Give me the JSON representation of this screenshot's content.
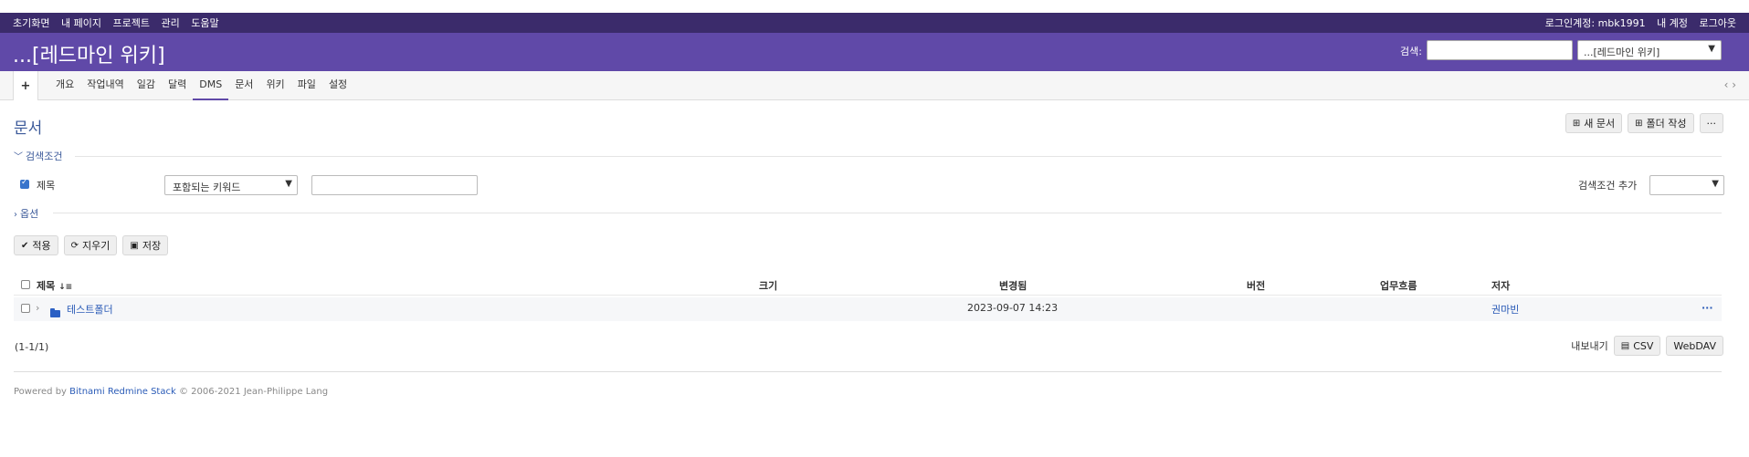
{
  "top_menu": {
    "items": [
      "초기화면",
      "내 페이지",
      "프로젝트",
      "관리",
      "도움말"
    ],
    "logged_in": "로그인계정: mbk1991",
    "my_account": "내 계정",
    "logout": "로그아웃"
  },
  "header": {
    "title": "...[레드마인 위키]",
    "search_label": "검색:",
    "project_jump": "...[레드마인 위키]"
  },
  "main_menu": {
    "new_object": "+",
    "tabs": [
      "개요",
      "작업내역",
      "일감",
      "달력",
      "DMS",
      "문서",
      "위키",
      "파일",
      "설정"
    ],
    "selected_tab": "DMS",
    "arrows": "‹ ›"
  },
  "page": {
    "title": "문서",
    "new_document": "새 문서",
    "new_folder": "폴더 작성",
    "more": "···"
  },
  "filters": {
    "legend": "검색조건",
    "field_label": "제목",
    "operator": "포함되는 키워드",
    "add_filter_label": "검색조건 추가"
  },
  "options": {
    "legend": "옵션"
  },
  "query_buttons": {
    "apply": "적용",
    "clear": "지우기",
    "save": "저장"
  },
  "table": {
    "headers": {
      "title": "제목",
      "size": "크기",
      "modified": "변경됨",
      "version": "버전",
      "workflow": "업무흐름",
      "author": "저자"
    },
    "sort_icon": "↓≡",
    "rows": [
      {
        "title": "테스트폴더",
        "size": "",
        "modified": "2023-09-07 14:23",
        "version": "",
        "workflow": "",
        "author": "권마빈",
        "more": "···"
      }
    ]
  },
  "pagination": {
    "count": "(1-1/1)"
  },
  "export": {
    "label": "내보내기",
    "csv": "CSV",
    "webdav": "WebDAV"
  },
  "footer": {
    "powered_by": "Powered by",
    "product": "Bitnami Redmine Stack",
    "copyright": "© 2006-2021 Jean-Philippe Lang"
  }
}
